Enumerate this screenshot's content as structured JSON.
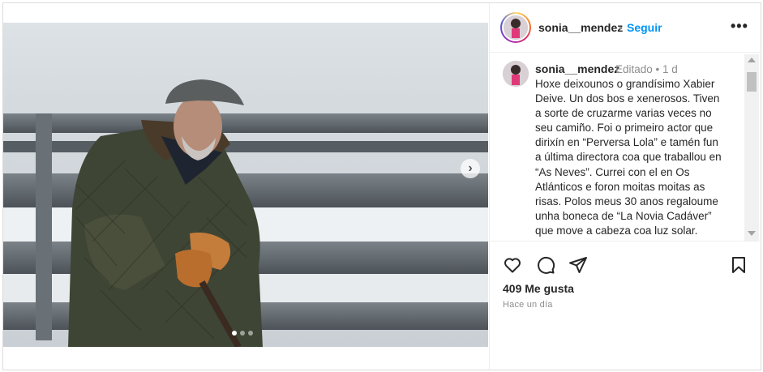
{
  "post": {
    "username": "sonia__mendez",
    "separator": "•",
    "follow_label": "Seguir",
    "more_label": "•••",
    "next_icon": "chevron-right-icon",
    "caption": {
      "username": "sonia__mendez",
      "edited_meta": "Editado • 1 d",
      "text": "Hoxe deixounos o grandísimo Xabier Deive. Un dos bos e xenerosos. Tiven a sorte de cruzarme varias veces no seu camiño. Foi o primeiro actor que dirixín en “Perversa Lola” e tamén fun a última directora coa que traballou en “As Neves”. Currei con el en Os Atlánticos e foron moitas moitas as risas. Polos meus 30 anos regaloume unha boneca de “La Novia Cadáver” que move a cabeza coa luz solar."
    },
    "likes": "409 Me gusta",
    "time_ago": "Hace un día",
    "icons": [
      "heart-icon",
      "comment-icon",
      "share-icon",
      "bookmark-icon"
    ],
    "colors": {
      "accent": "#0095f6",
      "text": "#262626",
      "muted": "#8e8e8e"
    }
  }
}
